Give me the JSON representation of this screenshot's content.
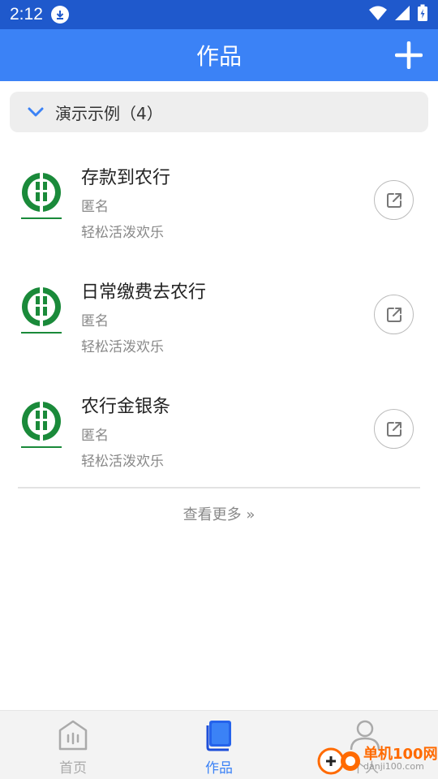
{
  "status_bar": {
    "time": "2:12"
  },
  "header": {
    "title": "作品"
  },
  "group": {
    "label": "演示示例（4）"
  },
  "items": [
    {
      "title": "存款到农行",
      "author": "匿名",
      "style": "轻松活泼欢乐"
    },
    {
      "title": "日常缴费去农行",
      "author": "匿名",
      "style": "轻松活泼欢乐"
    },
    {
      "title": "农行金银条",
      "author": "匿名",
      "style": "轻松活泼欢乐"
    }
  ],
  "more": {
    "label": "查看更多 »"
  },
  "nav": [
    {
      "label": "首页",
      "icon": "home-icon",
      "active": false
    },
    {
      "label": "作品",
      "icon": "works-icon",
      "active": true
    },
    {
      "label": "个人",
      "icon": "profile-icon",
      "active": false
    }
  ],
  "watermark": {
    "line1": "单机100网",
    "line2": "danji100.com"
  },
  "colors": {
    "status_bar": "#1f59cc",
    "app_bar": "#3b82f6",
    "accent": "#3b82f6",
    "logo_green": "#1a8a3a"
  }
}
